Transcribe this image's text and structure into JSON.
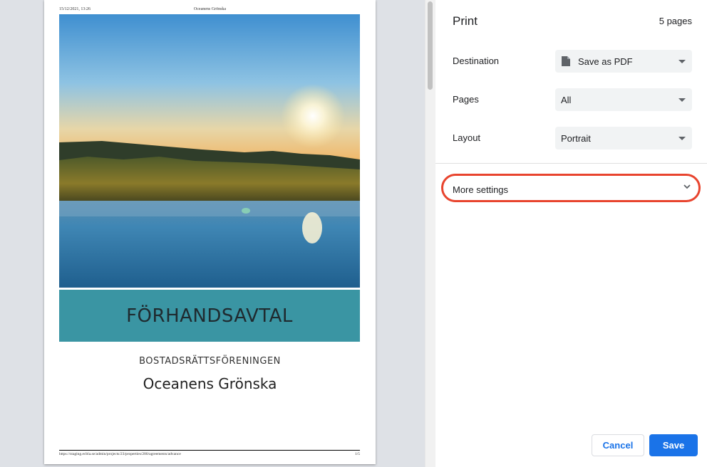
{
  "document": {
    "header_left": "15/12/2021, 13:26",
    "header_center": "Oceanens Grönska",
    "banner_title": "FÖRHANDSAVTAL",
    "subtitle": "BOSTADSRÄTTSFÖRENINGEN",
    "name": "Oceanens Grönska",
    "footer_url": "https://staging.ecbla.se/admin/projects/23/properties/280/agreements/advance",
    "footer_page": "1/5"
  },
  "panel": {
    "title": "Print",
    "page_count": "5 pages",
    "destination": {
      "label": "Destination",
      "value": "Save as PDF",
      "icon": "document-icon"
    },
    "pages": {
      "label": "Pages",
      "value": "All"
    },
    "layout": {
      "label": "Layout",
      "value": "Portrait"
    },
    "more_settings": {
      "label": "More settings",
      "icon": "chevron-down-icon"
    },
    "cancel_label": "Cancel",
    "save_label": "Save"
  },
  "colors": {
    "banner": "#3a95a3",
    "accent": "#1a73e8",
    "highlight": "#e8442e"
  }
}
